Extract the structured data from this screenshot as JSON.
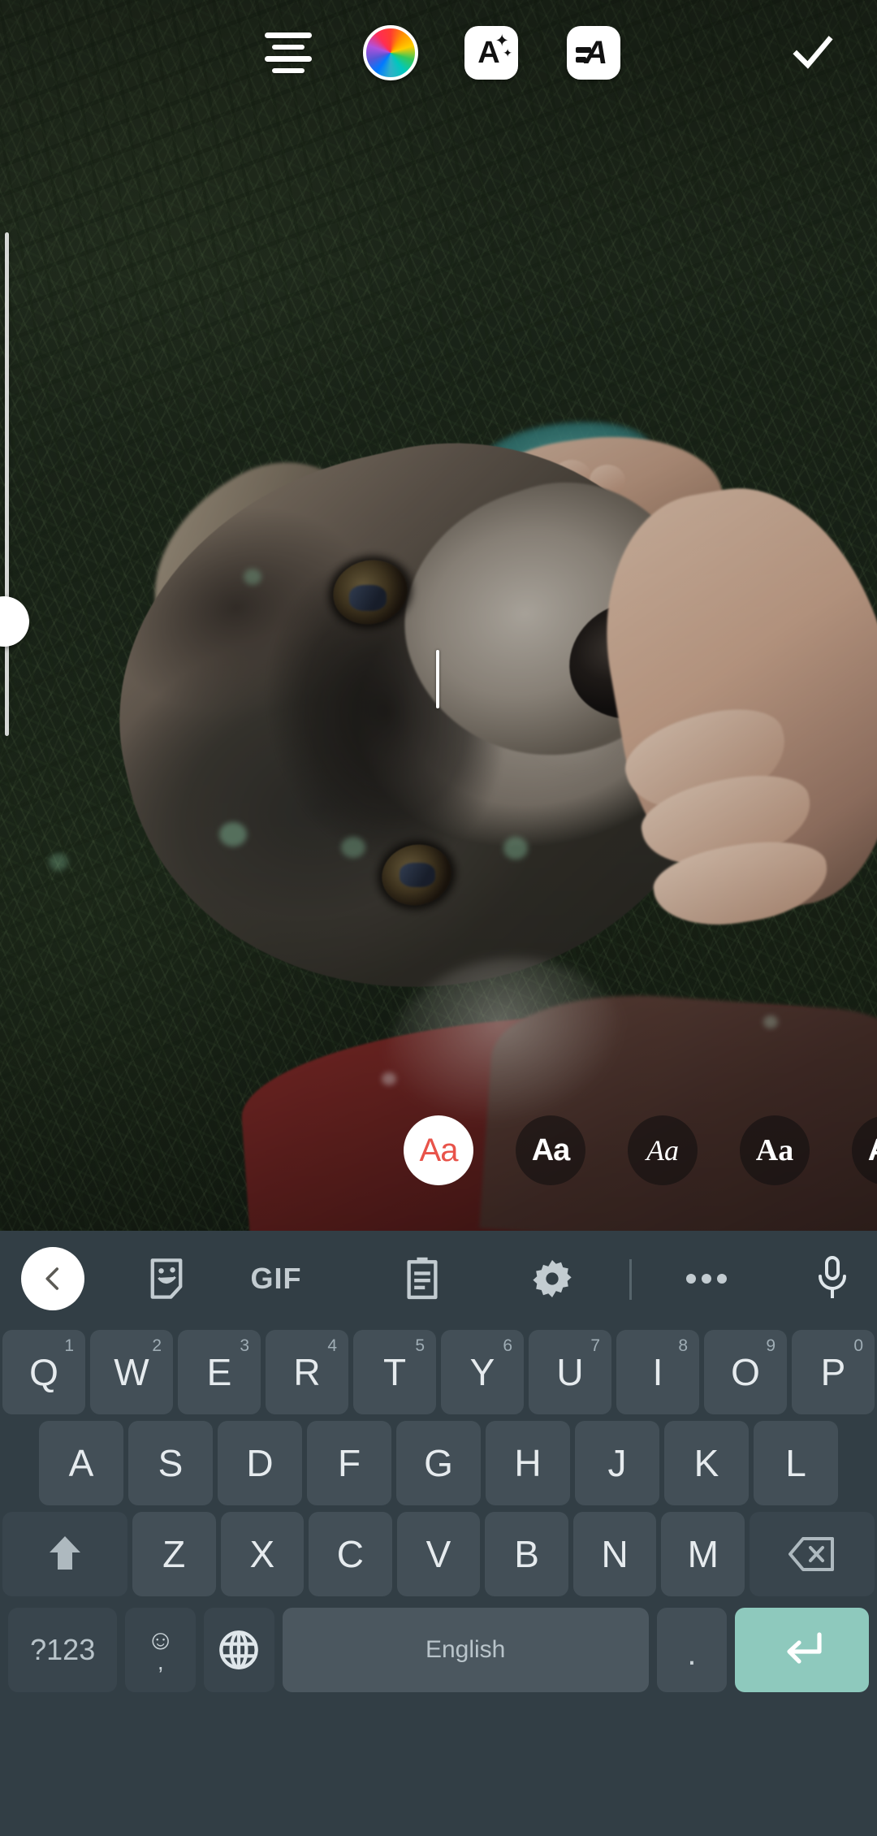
{
  "app": {
    "screen_name": "story-text-editor",
    "accent_color": "#e8534a",
    "keyboard_bg": "#323e45",
    "key_bg": "#434f57",
    "enter_key_color": "#8ec9bd"
  },
  "top_toolbar": {
    "align_button": {
      "name": "text-alignment",
      "icon": "align-center-icon"
    },
    "color_button": {
      "name": "text-color",
      "icon": "color-wheel-icon"
    },
    "effects_button": {
      "name": "text-effects",
      "icon": "a-sparkle-icon",
      "glyph": "A"
    },
    "style_button": {
      "name": "text-style",
      "icon": "a-style-icon",
      "glyph": "A"
    },
    "done_button": {
      "name": "done",
      "icon": "checkmark-icon"
    }
  },
  "size_slider": {
    "name": "text-size-slider",
    "orientation": "vertical"
  },
  "text_cursor": {
    "name": "text-caret",
    "visible": true
  },
  "font_carousel": {
    "label": "Aa",
    "options": [
      {
        "label": "Aa",
        "style": "classic",
        "selected": true
      },
      {
        "label": "Aa",
        "style": "modern",
        "selected": false
      },
      {
        "label": "Aa",
        "style": "script",
        "selected": false
      },
      {
        "label": "Aa",
        "style": "serif",
        "selected": false
      },
      {
        "label": "Aa",
        "style": "bold",
        "selected": false
      }
    ]
  },
  "keyboard": {
    "toolbar": [
      {
        "name": "back-button",
        "icon": "chevron-left-icon"
      },
      {
        "name": "sticker-button",
        "icon": "sticker-face-icon"
      },
      {
        "name": "gif-button",
        "icon": "gif-icon",
        "label": "GIF"
      },
      {
        "name": "clipboard-button",
        "icon": "clipboard-icon"
      },
      {
        "name": "settings-button",
        "icon": "gear-icon"
      },
      {
        "name": "more-button",
        "icon": "ellipsis-icon"
      },
      {
        "name": "voice-button",
        "icon": "microphone-icon"
      }
    ],
    "row1": [
      {
        "key": "Q",
        "sup": "1"
      },
      {
        "key": "W",
        "sup": "2"
      },
      {
        "key": "E",
        "sup": "3"
      },
      {
        "key": "R",
        "sup": "4"
      },
      {
        "key": "T",
        "sup": "5"
      },
      {
        "key": "Y",
        "sup": "6"
      },
      {
        "key": "U",
        "sup": "7"
      },
      {
        "key": "I",
        "sup": "8"
      },
      {
        "key": "O",
        "sup": "9"
      },
      {
        "key": "P",
        "sup": "0"
      }
    ],
    "row2": [
      "A",
      "S",
      "D",
      "F",
      "G",
      "H",
      "J",
      "K",
      "L"
    ],
    "row3": {
      "shift": {
        "name": "shift-key",
        "icon": "shift-arrow-icon"
      },
      "letters": [
        "Z",
        "X",
        "C",
        "V",
        "B",
        "N",
        "M"
      ],
      "backspace": {
        "name": "backspace-key",
        "icon": "backspace-icon"
      }
    },
    "row4": {
      "symbols": "?123",
      "emoji": {
        "face": "☺",
        "comma": ","
      },
      "globe": {
        "name": "language-key",
        "icon": "globe-icon"
      },
      "space": "English",
      "period": ".",
      "enter": {
        "name": "enter-key",
        "icon": "return-arrow-icon"
      }
    }
  }
}
